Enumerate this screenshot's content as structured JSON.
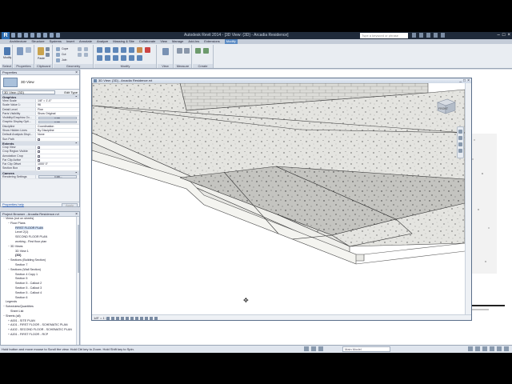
{
  "app": {
    "logo": "R",
    "window_title": "Autodesk Revit 2014 - [3D View: {3D} - Arcadia Residence]",
    "search_placeholder": "Type a keyword or phrase"
  },
  "ribbon": {
    "tabs": [
      "Architecture",
      "Structure",
      "Systems",
      "Insert",
      "Annotate",
      "Analyze",
      "Massing & Site",
      "Collaborate",
      "View",
      "Manage",
      "Add-Ins",
      "Extensions",
      "Modify"
    ],
    "active_tab": "Modify",
    "panels": [
      "Select",
      "Properties",
      "Clipboard",
      "Geometry",
      "Modify",
      "View",
      "Measure",
      "Create"
    ],
    "tools": {
      "modify": "Modify",
      "paste": "Paste",
      "cope": "Cope",
      "cut": "Cut",
      "join": "Join"
    }
  },
  "properties": {
    "header": "Properties",
    "close": "×",
    "type_name": "3D View",
    "instance_selector": "3D View: {3D}",
    "edit_type": "Edit Type",
    "groups": {
      "graphics": "Graphics",
      "extents": "Extents",
      "camera": "Camera"
    },
    "graphics_rows": [
      {
        "k": "View Scale",
        "v": "1/8\" = 1'-0\""
      },
      {
        "k": "Scale Value    1:",
        "v": "96"
      },
      {
        "k": "Detail Level",
        "v": "Fine"
      },
      {
        "k": "Parts Visibility",
        "v": "Show Original"
      },
      {
        "k": "Visibility/Graphics Ov...",
        "v": "Edit..."
      },
      {
        "k": "Graphic Display Opti...",
        "v": "Edit..."
      },
      {
        "k": "Discipline",
        "v": "Coordination"
      },
      {
        "k": "Show Hidden Lines",
        "v": "By Discipline"
      },
      {
        "k": "Default Analysis Displ...",
        "v": "None"
      },
      {
        "k": "Sun Path",
        "v": ""
      }
    ],
    "extents_rows": [
      {
        "k": "Crop View",
        "v": ""
      },
      {
        "k": "Crop Region Visible",
        "v": ""
      },
      {
        "k": "Annotation Crop",
        "v": ""
      },
      {
        "k": "Far Clip Active",
        "v": ""
      },
      {
        "k": "Far Clip Offset",
        "v": "1000' 0\""
      },
      {
        "k": "Section Box",
        "v": ""
      }
    ],
    "camera_rows": [
      {
        "k": "Rendering Settings",
        "v": "Edit..."
      }
    ],
    "help_link": "Properties help",
    "apply": "Apply"
  },
  "browser": {
    "header": "Project Browser - Arcadia Residence.rvt",
    "items": [
      {
        "label": "Views (not on sheets)",
        "indent": 0,
        "toggle": "−",
        "bold": false
      },
      {
        "label": "Floor Plans",
        "indent": 1,
        "toggle": "−",
        "bold": false
      },
      {
        "label": "FIRST FLOOR PLAN",
        "indent": 2,
        "toggle": "",
        "bold": false,
        "selected": true
      },
      {
        "label": "Level 2(1)",
        "indent": 2,
        "toggle": "",
        "bold": false
      },
      {
        "label": "SECOND FLOOR PLAN",
        "indent": 2,
        "toggle": "",
        "bold": false
      },
      {
        "label": "working - First floor plan",
        "indent": 2,
        "toggle": "",
        "bold": false
      },
      {
        "label": "3D Views",
        "indent": 1,
        "toggle": "−",
        "bold": false
      },
      {
        "label": "3D View 1",
        "indent": 2,
        "toggle": "",
        "bold": false
      },
      {
        "label": "{3D}",
        "indent": 2,
        "toggle": "",
        "bold": true
      },
      {
        "label": "Sections (Building Section)",
        "indent": 1,
        "toggle": "−",
        "bold": false
      },
      {
        "label": "Section 7",
        "indent": 2,
        "toggle": "",
        "bold": false
      },
      {
        "label": "Sections (Wall Section)",
        "indent": 1,
        "toggle": "−",
        "bold": false
      },
      {
        "label": "Section 4 Copy 1",
        "indent": 2,
        "toggle": "",
        "bold": false
      },
      {
        "label": "Section 5",
        "indent": 2,
        "toggle": "",
        "bold": false
      },
      {
        "label": "Section 5 - Callout 2",
        "indent": 2,
        "toggle": "",
        "bold": false
      },
      {
        "label": "Section 5 - Callout 3",
        "indent": 2,
        "toggle": "",
        "bold": false
      },
      {
        "label": "Section 5 - Callout 4",
        "indent": 2,
        "toggle": "",
        "bold": false
      },
      {
        "label": "Section 6",
        "indent": 2,
        "toggle": "",
        "bold": false
      },
      {
        "label": "Legends",
        "indent": 0,
        "toggle": "",
        "bold": false
      },
      {
        "label": "Schedules/Quantities",
        "indent": 0,
        "toggle": "−",
        "bold": false
      },
      {
        "label": "Sheet List",
        "indent": 1,
        "toggle": "",
        "bold": false
      },
      {
        "label": "Sheets (all)",
        "indent": 0,
        "toggle": "−",
        "bold": false
      },
      {
        "label": "A001 - SITE PLAN",
        "indent": 1,
        "toggle": "+",
        "bold": false
      },
      {
        "label": "A101 - FIRST FLOOR - SCHEMATIC PLAN",
        "indent": 1,
        "toggle": "+",
        "bold": false
      },
      {
        "label": "A102 - SECOND FLOOR - SCHEMATIC PLAN",
        "indent": 1,
        "toggle": "+",
        "bold": false
      },
      {
        "label": "A201 - FIRST FLOOR - RCP",
        "indent": 1,
        "toggle": "+",
        "bold": false
      }
    ]
  },
  "view_window": {
    "title": "3D View: {3D} - Arcadia Residence.rvt",
    "controls": [
      "_",
      "□",
      "×"
    ],
    "scale_label": "1/8\" = 1'-0\"",
    "viewcube_label": "FRONT"
  },
  "statusbar": {
    "message": "Hold button and move mouse to Scroll the view. Hold Ctrl key to Zoom. Hold Shift key to Spin.",
    "model_label": "Main Model"
  }
}
